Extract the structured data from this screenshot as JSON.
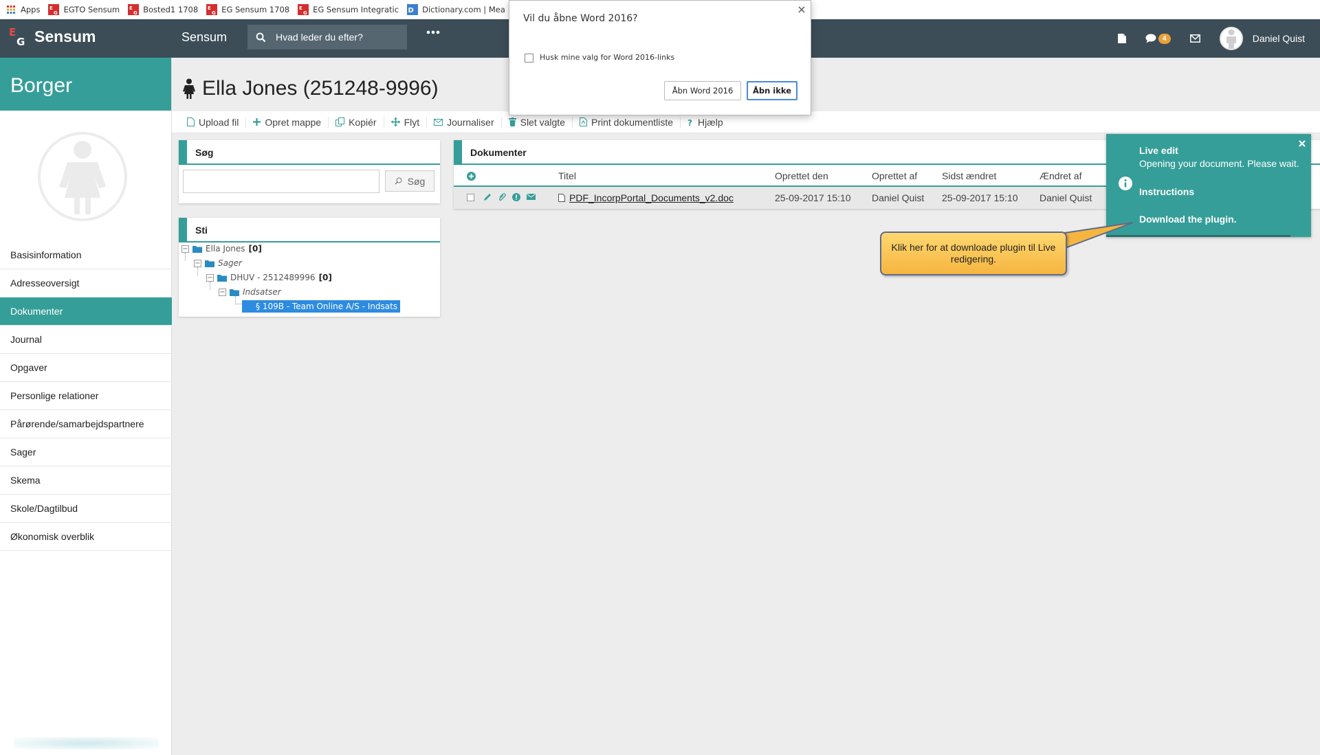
{
  "colors": {
    "teal": "#369e99",
    "nav_bg": "#3c4d57",
    "badge": "#e8a13a",
    "selected_blue": "#2d8be1",
    "callout_yellow": "#ffd870"
  },
  "bookmarks": [
    {
      "label": "Apps",
      "icon": "apps-grid-icon"
    },
    {
      "label": "EGTO Sensum",
      "icon": "eg-logo-icon"
    },
    {
      "label": "Bosted1 1708",
      "icon": "eg-logo-icon"
    },
    {
      "label": "EG Sensum 1708",
      "icon": "eg-logo-icon"
    },
    {
      "label": "EG Sensum Integratic",
      "icon": "eg-logo-icon"
    },
    {
      "label": "Dictionary.com | Mea",
      "icon": "dictionary-icon"
    }
  ],
  "nav": {
    "brand": "Sensum",
    "product": "Sensum",
    "search_placeholder": "Hvad leder du efter?",
    "chat_count": "4",
    "user_name": "Daniel Quist"
  },
  "sidebar": {
    "header": "Borger",
    "items": [
      {
        "label": "Basisinformation",
        "active": false
      },
      {
        "label": "Adresseoversigt",
        "active": false
      },
      {
        "label": "Dokumenter",
        "active": true
      },
      {
        "label": "Journal",
        "active": false
      },
      {
        "label": "Opgaver",
        "active": false
      },
      {
        "label": "Personlige relationer",
        "active": false
      },
      {
        "label": "Pårørende/samarbejdspartnere",
        "active": false
      },
      {
        "label": "Sager",
        "active": false
      },
      {
        "label": "Skema",
        "active": false
      },
      {
        "label": "Skole/Dagtilbud",
        "active": false
      },
      {
        "label": "Økonomisk overblik",
        "active": false
      }
    ]
  },
  "person": {
    "title": "Ella Jones (251248-9996)"
  },
  "toolbar": {
    "upload": "Upload fil",
    "new_folder": "Opret mappe",
    "copy": "Kopiér",
    "move": "Flyt",
    "journalize": "Journaliser",
    "delete": "Slet valgte",
    "print": "Print dokumentliste",
    "help": "Hjælp"
  },
  "search_panel": {
    "title": "Søg",
    "button": "Søg",
    "value": ""
  },
  "path_panel": {
    "title": "Sti",
    "tree": {
      "root": "Ella Jones",
      "root_count": "[0]",
      "sager": "Sager",
      "case": "DHUV - 2512489996",
      "case_count": "[0]",
      "indsatser": "Indsatser",
      "selected": "§ 109B - Team Online A/S - Indsats"
    }
  },
  "documents": {
    "title": "Dokumenter",
    "columns": {
      "title": "Titel",
      "created": "Oprettet den",
      "created_by": "Oprettet af",
      "modified": "Sidst ændret",
      "modified_by": "Ændret af"
    },
    "rows": [
      {
        "title": "PDF_IncorpPortal_Documents_v2.doc",
        "created": "25-09-2017 15:10",
        "created_by": "Daniel Quist",
        "modified": "25-09-2017 15:10",
        "modified_by": "Daniel Quist"
      }
    ]
  },
  "dialog": {
    "title": "Vil du åbne Word 2016?",
    "checkbox_label": "Husk mine valg for Word 2016-links",
    "open_button": "Åbn Word 2016",
    "cancel_button": "Åbn ikke"
  },
  "toast": {
    "title": "Live edit",
    "message": "Opening your document. Please wait.",
    "instructions": "Instructions",
    "download": "Download the plugin."
  },
  "callout": {
    "text": "Klik her for at downloade plugin til Live redigering."
  }
}
